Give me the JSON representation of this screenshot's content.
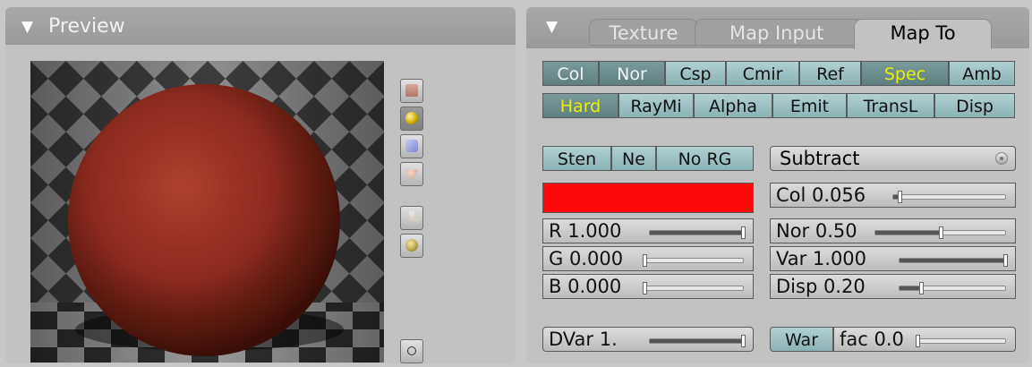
{
  "preview": {
    "title": "Preview",
    "shapes": [
      "plane-icon",
      "sphere-icon",
      "cube-icon",
      "monkey-icon",
      "hair-icon",
      "sky-sphere-icon",
      "world-icon"
    ]
  },
  "texture_panel": {
    "tabs": [
      {
        "label": "Texture"
      },
      {
        "label": "Map Input"
      },
      {
        "label": "Map To",
        "active": true
      }
    ],
    "mapto_row1": [
      "Col",
      "Nor",
      "Csp",
      "Cmir",
      "Ref",
      "Spec",
      "Amb"
    ],
    "mapto_row2": [
      "Hard",
      "RayMi",
      "Alpha",
      "Emit",
      "TransL",
      "Disp"
    ],
    "sten_label": "Sten",
    "neg_label": "Ne",
    "norgb_label": "No RG",
    "blend_mode": "Subtract",
    "color": "#ff0a0a",
    "r_label": "R 1.000",
    "r_value": 1.0,
    "g_label": "G 0.000",
    "g_value": 0.0,
    "b_label": "B 0.000",
    "b_value": 0.0,
    "dvar_label": "DVar 1.",
    "dvar_value": 1.0,
    "col_label": "Col 0.056",
    "col_value": 0.056,
    "nor_label": "Nor 0.50",
    "nor_value": 0.5,
    "var_label": "Var 1.000",
    "var_value": 1.0,
    "disp_label": "Disp 0.20",
    "disp_value": 0.2,
    "war_label": "War",
    "warpfac_label": "fac 0.0",
    "warpfac_value": 0.0,
    "highlight_color": "#ecf000",
    "active_toggle_color": "#6c8c8e"
  }
}
